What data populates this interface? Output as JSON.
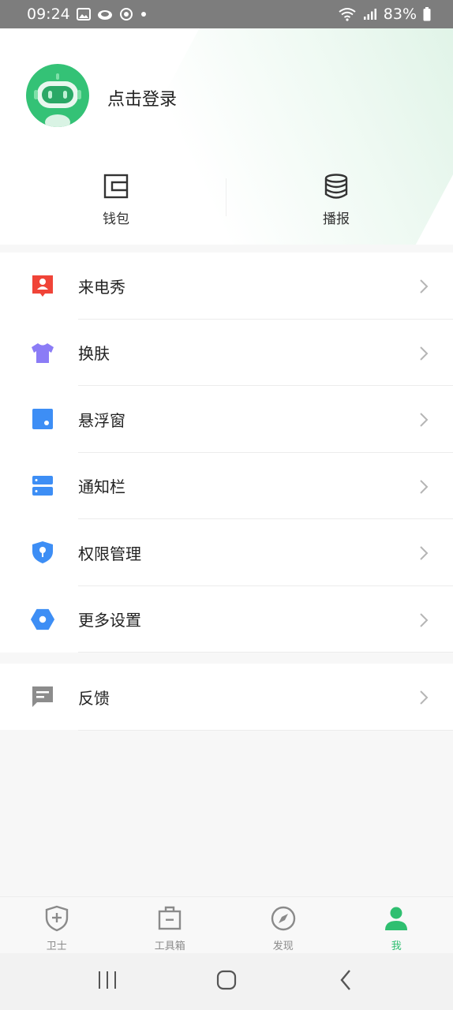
{
  "status_bar": {
    "time": "09:24",
    "battery": "83%",
    "icons": [
      "gallery-icon",
      "cloud-icon",
      "sync-icon",
      "dot-icon",
      "wifi-icon",
      "signal-icon",
      "battery-icon"
    ]
  },
  "profile": {
    "login_label": "点击登录",
    "avatar_icon": "robot-avatar-icon",
    "avatar_color": "#34c276"
  },
  "quick_actions": [
    {
      "label": "钱包",
      "icon": "wallet-icon"
    },
    {
      "label": "播报",
      "icon": "database-icon"
    }
  ],
  "menu": {
    "items": [
      {
        "label": "来电秀",
        "icon": "caller-show-icon",
        "color": "#f04438"
      },
      {
        "label": "换肤",
        "icon": "tshirt-icon",
        "color": "#8b7cf6"
      },
      {
        "label": "悬浮窗",
        "icon": "floating-window-icon",
        "color": "#3d8ef5"
      },
      {
        "label": "通知栏",
        "icon": "notification-bar-icon",
        "color": "#3d8ef5"
      },
      {
        "label": "权限管理",
        "icon": "shield-key-icon",
        "color": "#3d8ef5"
      },
      {
        "label": "更多设置",
        "icon": "hexagon-settings-icon",
        "color": "#3d8ef5"
      }
    ],
    "feedback": {
      "label": "反馈",
      "icon": "feedback-icon",
      "color": "#8c8c8c"
    }
  },
  "tabs": [
    {
      "label": "卫士",
      "icon": "shield-plus-icon",
      "active": false
    },
    {
      "label": "工具箱",
      "icon": "toolbox-icon",
      "active": false
    },
    {
      "label": "发现",
      "icon": "compass-icon",
      "active": false
    },
    {
      "label": "我",
      "icon": "person-icon",
      "active": true
    }
  ],
  "accent_color": "#2fbf70"
}
